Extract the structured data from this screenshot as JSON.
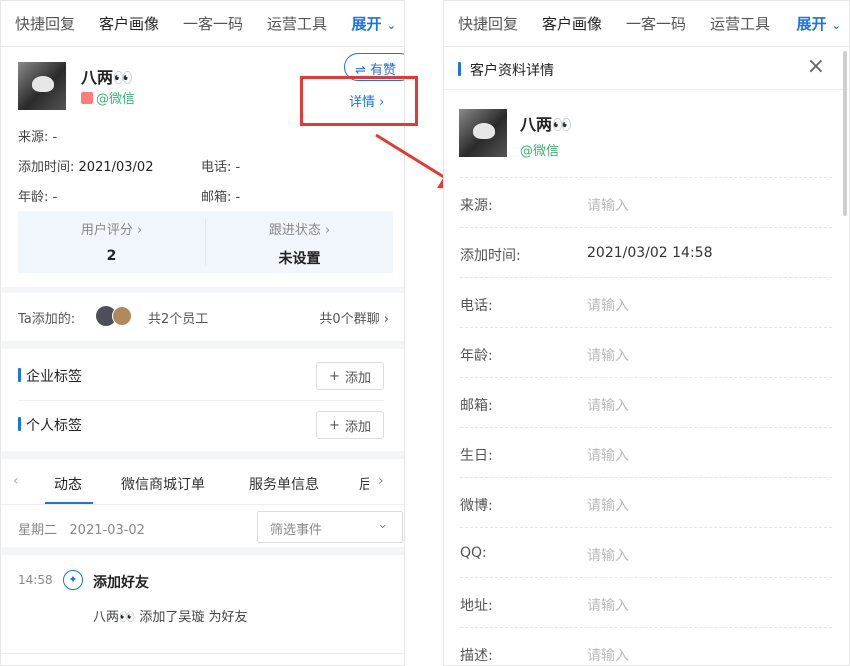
{
  "tabs": [
    "快捷回复",
    "客户画像",
    "一客一码",
    "运营工具"
  ],
  "expand_label": "展开",
  "right_tabs": [
    "快捷回复",
    "客户画像",
    "一客一码",
    "运营工具"
  ],
  "right_expand_label": "展开",
  "youzan_label": "有赞",
  "customer": {
    "name": "八两👀",
    "channel": "@微信"
  },
  "details_link": "详情",
  "info": {
    "source_label": "来源:",
    "source_value": "-",
    "add_time_label": "添加时间:",
    "add_time_value": "2021/03/02",
    "phone_label": "电话:",
    "phone_value": "-",
    "age_label": "年龄:",
    "age_value": "-",
    "email_label": "邮箱:",
    "email_value": "-"
  },
  "score": {
    "rating_label": "用户评分",
    "rating_value": "2",
    "status_label": "跟进状态",
    "status_value": "未设置"
  },
  "added": {
    "label": "Ta添加的:",
    "staff": "共2个员工",
    "groups": "共0个群聊"
  },
  "tags": {
    "enterprise": "企业标签",
    "personal": "个人标签",
    "add": "添加"
  },
  "subtabs": [
    "动态",
    "微信商城订单",
    "服务单信息",
    "后"
  ],
  "timeline": {
    "date": "星期二   2021-03-02",
    "filter_placeholder": "筛选事件",
    "time": "14:58",
    "event_title": "添加好友",
    "event_desc": "八两👀 添加了吴璇 为好友"
  },
  "panel": {
    "title": "客户资料详情",
    "name": "八两👀",
    "channel": "@微信",
    "placeholder": "请输入",
    "fields": [
      {
        "label": "来源:",
        "value": ""
      },
      {
        "label": "添加时间:",
        "value": "2021/03/02 14:58"
      },
      {
        "label": "电话:",
        "value": ""
      },
      {
        "label": "年龄:",
        "value": ""
      },
      {
        "label": "邮箱:",
        "value": ""
      },
      {
        "label": "生日:",
        "value": ""
      },
      {
        "label": "微博:",
        "value": ""
      },
      {
        "label": "QQ:",
        "value": ""
      },
      {
        "label": "地址:",
        "value": ""
      },
      {
        "label": "描述:",
        "value": ""
      }
    ]
  },
  "colors": {
    "accent": "#1a73e8",
    "wechat": "#3cb371",
    "highlight": "#e53935"
  }
}
